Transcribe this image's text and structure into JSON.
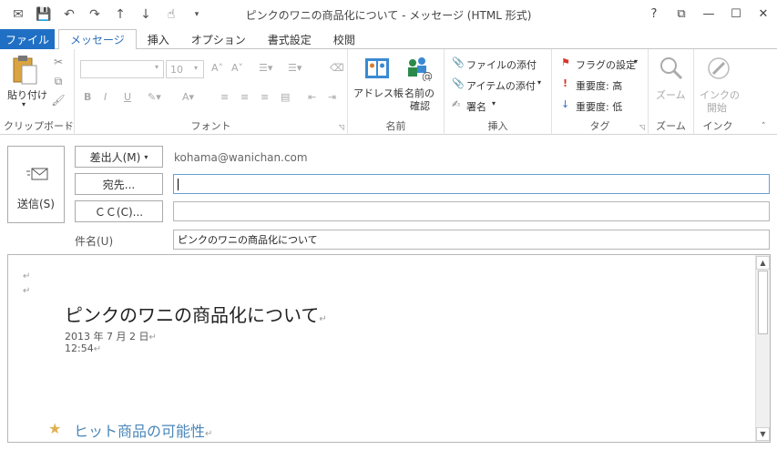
{
  "window": {
    "title": "ピンクのワニの商品化について - メッセージ (HTML 形式)",
    "controls": [
      "?",
      "⧉",
      "—",
      "☐",
      "✕"
    ]
  },
  "qat": {
    "icons": [
      "mail-icon",
      "save-icon",
      "undo-icon",
      "redo-icon",
      "up-arrow-icon",
      "down-arrow-icon",
      "touch-icon",
      "customize-icon"
    ]
  },
  "tabs": {
    "file": "ファイル",
    "items": [
      "メッセージ",
      "挿入",
      "オプション",
      "書式設定",
      "校閲"
    ],
    "active_index": 0
  },
  "ribbon": {
    "clipboard": {
      "paste": "貼り付け",
      "label": "クリップボード"
    },
    "font": {
      "size_value": "10",
      "label": "フォント"
    },
    "names": {
      "address_book": "アドレス帳",
      "check_names_1": "名前の",
      "check_names_2": "確認",
      "label": "名前"
    },
    "include": {
      "attach_file": "ファイルの添付",
      "attach_item": "アイテムの添付",
      "signature": "署名",
      "label": "挿入"
    },
    "tags": {
      "follow_up": "フラグの設定",
      "high": "重要度: 高",
      "low": "重要度: 低",
      "label": "タグ"
    },
    "zoom": {
      "button": "ズーム",
      "label": "ズーム"
    },
    "ink": {
      "button_1": "インクの",
      "button_2": "開始",
      "label": "インク"
    }
  },
  "header": {
    "send": "送信(S)",
    "from_button": "差出人(M)",
    "from_address": "kohama@wanichan.com",
    "to_button": "宛先...",
    "to_value": "",
    "cc_button": "ＣＣ(C)...",
    "cc_value": "",
    "subject_label": "件名(U)",
    "subject_value": "ピンクのワニの商品化について"
  },
  "body": {
    "title": "ピンクのワニの商品化について",
    "date": "2013 年 7 月 2 日",
    "time": "12:54",
    "heading": "ヒット商品の可能性",
    "para_mark": "↵"
  },
  "colors": {
    "file_tab": "#1f6fc4",
    "active_tab_text": "#2c6dba",
    "heading": "#4a86b8",
    "star": "#e0b050",
    "flag": "#d9342b",
    "importance_high": "#d9342b",
    "importance_low": "#2a6fc9"
  }
}
